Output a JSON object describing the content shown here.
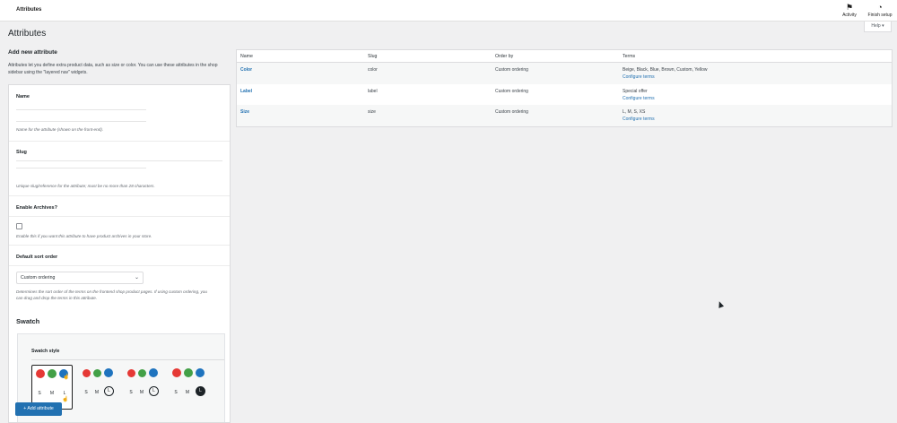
{
  "header": {
    "title": "Attributes",
    "activity_label": "Activity",
    "finish_setup_label": "Finish setup",
    "help_label": "Help ▾"
  },
  "page": {
    "title": "Attributes"
  },
  "add_new": {
    "heading": "Add new attribute",
    "description": "Attributes let you define extra product data, such as size or color. You can use these attributes in the shop sidebar using the \"layered nav\" widgets.",
    "name_label": "Name",
    "name_value": "",
    "name_help": "Name for the attribute (shown on the front-end).",
    "slug_label": "Slug",
    "slug_value": "",
    "slug_help": "Unique slug/reference for the attribute; must be no more than 28 characters.",
    "archives_label": "Enable Archives?",
    "archives_help": "Enable this if you want this attribute to have product archives in your store.",
    "sort_label": "Default sort order",
    "sort_value": "Custom ordering",
    "sort_help": "Determines the sort order of the terms on the frontend shop product pages. If using custom ordering, you can drag and drop the terms in this attribute.",
    "swatch_heading": "Swatch",
    "swatch_style_label": "Swatch style",
    "swatch_sizes": [
      "S",
      "M",
      "L"
    ],
    "submit_label": "+ Add attribute"
  },
  "colors": {
    "red": "#e53935",
    "green": "#43a047",
    "blue": "#1e73be",
    "accent": "#2271b1"
  },
  "table": {
    "headers": [
      "Name",
      "Slug",
      "Order by",
      "Terms"
    ],
    "configure_label": "Configure terms",
    "rows": [
      {
        "name": "Color",
        "slug": "color",
        "order": "Custom ordering",
        "terms": "Beige, Black, Blue, Brown, Custom, Yellow"
      },
      {
        "name": "Label",
        "slug": "label",
        "order": "Custom ordering",
        "terms": "Special offer"
      },
      {
        "name": "Size",
        "slug": "size",
        "order": "Custom ordering",
        "terms": "L, M, S, XS"
      }
    ]
  }
}
